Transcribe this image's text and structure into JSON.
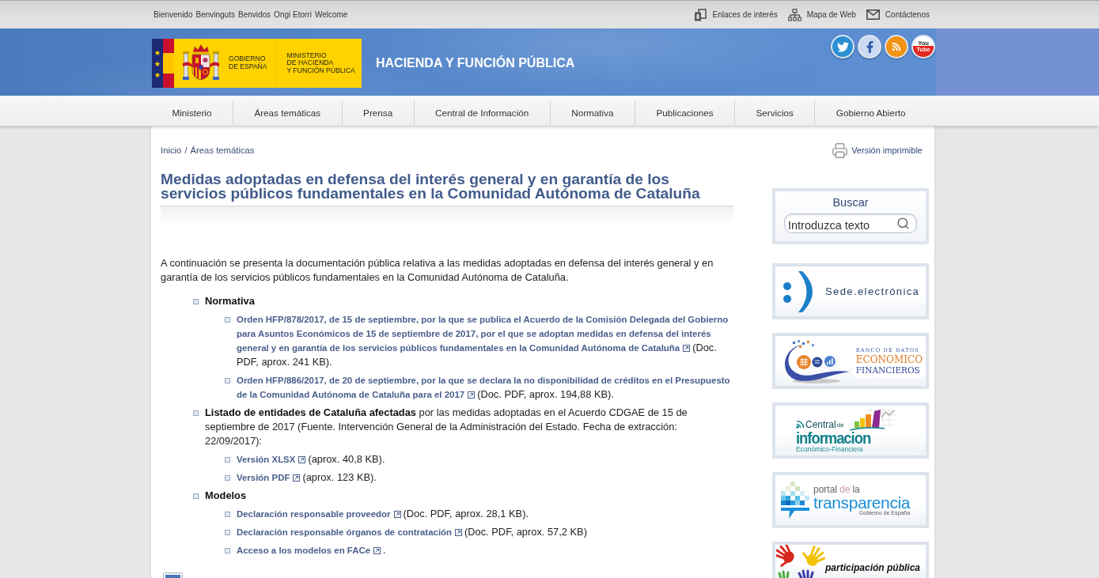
{
  "top_bar": {
    "languages": [
      "Bienvenido",
      "Benvinguts",
      "Benvidos",
      "Ongi Etorri",
      "Welcome"
    ],
    "links": [
      {
        "kind": "links",
        "label": "Enlaces de interés"
      },
      {
        "kind": "sitemap",
        "label": "Mapa de Web"
      },
      {
        "kind": "contact",
        "label": "Contáctenos"
      }
    ]
  },
  "header": {
    "logo": {
      "government": [
        "GOBIERNO",
        "DE ESPAÑA"
      ],
      "ministry": [
        "MINISTERIO",
        "DE HACIENDA",
        "Y FUNCIÓN PÚBLICA"
      ]
    },
    "title": "HACIENDA Y FUNCIÓN PÚBLICA",
    "social": [
      {
        "kind": "twitter"
      },
      {
        "kind": "facebook"
      },
      {
        "kind": "rss"
      },
      {
        "kind": "youtube",
        "label": [
          "You",
          "Tube"
        ]
      }
    ]
  },
  "nav": [
    "Ministerio",
    "Áreas temáticas",
    "Prensa",
    "Central de Información",
    "Normativa",
    "Publicaciones",
    "Servicios",
    "Gobierno Abierto"
  ],
  "breadcrumb": {
    "items": [
      "Inicio",
      "Áreas temáticas"
    ],
    "separator": "/"
  },
  "print_link": "Versión imprimible",
  "article": {
    "title": "Medidas adoptadas en defensa del interés general y en garantía de los servicios públicos fundamentales en la Comunidad Autónoma de Cataluña",
    "intro": "A continuación se presenta la documentación pública relativa a las medidas adoptadas en defensa del interés general y en garantía de los servicios públicos fundamentales en la Comunidad Autónoma de Cataluña.",
    "sections": [
      {
        "kind": "heading",
        "text": "Normativa",
        "items": [
          {
            "link": "Orden HFP/878/2017, de 15 de septiembre, por la que se publica el Acuerdo de la Comisión Delegada del Gobierno para Asuntos Económicos de 15 de septiembre de 2017, por el que se adoptan medidas en defensa del interés general y en garantía de los servicios públicos fundamentales en la Comunidad Autónoma de Cataluña",
            "note": "(Doc. PDF, aprox. 241 KB)."
          },
          {
            "link": "Orden HFP/886/2017, de 20 de septiembre, por la que se declara la no disponibilidad de créditos en el Presupuesto de la Comunidad Autónoma de Cataluña para el 2017",
            "note": "(Doc. PDF, aprox. 194,88 KB)."
          }
        ]
      },
      {
        "kind": "paragraph",
        "text": "**Listado de entidades de Cataluña afectadas** por las medidas adoptadas en el Acuerdo CDGAE de 15 de septiembre de 2017 (Fuente. Intervención General de la Administración del Estado. Fecha de extracción: 22/09/2017):",
        "items": [
          {
            "link": "Versión XLSX",
            "note": "(aprox. 40,8 KB)."
          },
          {
            "link": "Versión PDF",
            "note": "(aprox. 123 KB)."
          }
        ]
      },
      {
        "kind": "heading",
        "text": "Modelos",
        "items": [
          {
            "link": "Declaración responsable proveedor",
            "note": "(Doc. PDF, aprox. 28,1 KB)."
          },
          {
            "link": "Declaración responsable órganos de contratación",
            "note": "(Doc. PDF, aprox. 57,2 KB)"
          },
          {
            "link": "Acceso a los modelos en FACe",
            "note": "."
          }
        ]
      }
    ]
  },
  "sidebar": {
    "search": {
      "title": "Buscar",
      "placeholder": "Introduzca texto"
    },
    "banners": [
      {
        "kind": "sede",
        "texts": [
          "Sede.electrónica"
        ]
      },
      {
        "kind": "datos",
        "texts": [
          "BANCO DE DATOS",
          "ECONOMICO",
          "FINANCIEROS"
        ]
      },
      {
        "kind": "central",
        "texts": [
          "Central",
          "de",
          "informacion",
          "Económico-Financiera"
        ]
      },
      {
        "kind": "transparencia",
        "texts": [
          "portal",
          "de",
          "la",
          "transparencia",
          "Gobierno de España"
        ]
      },
      {
        "kind": "participacion",
        "texts": [
          "participación pública"
        ]
      }
    ]
  }
}
